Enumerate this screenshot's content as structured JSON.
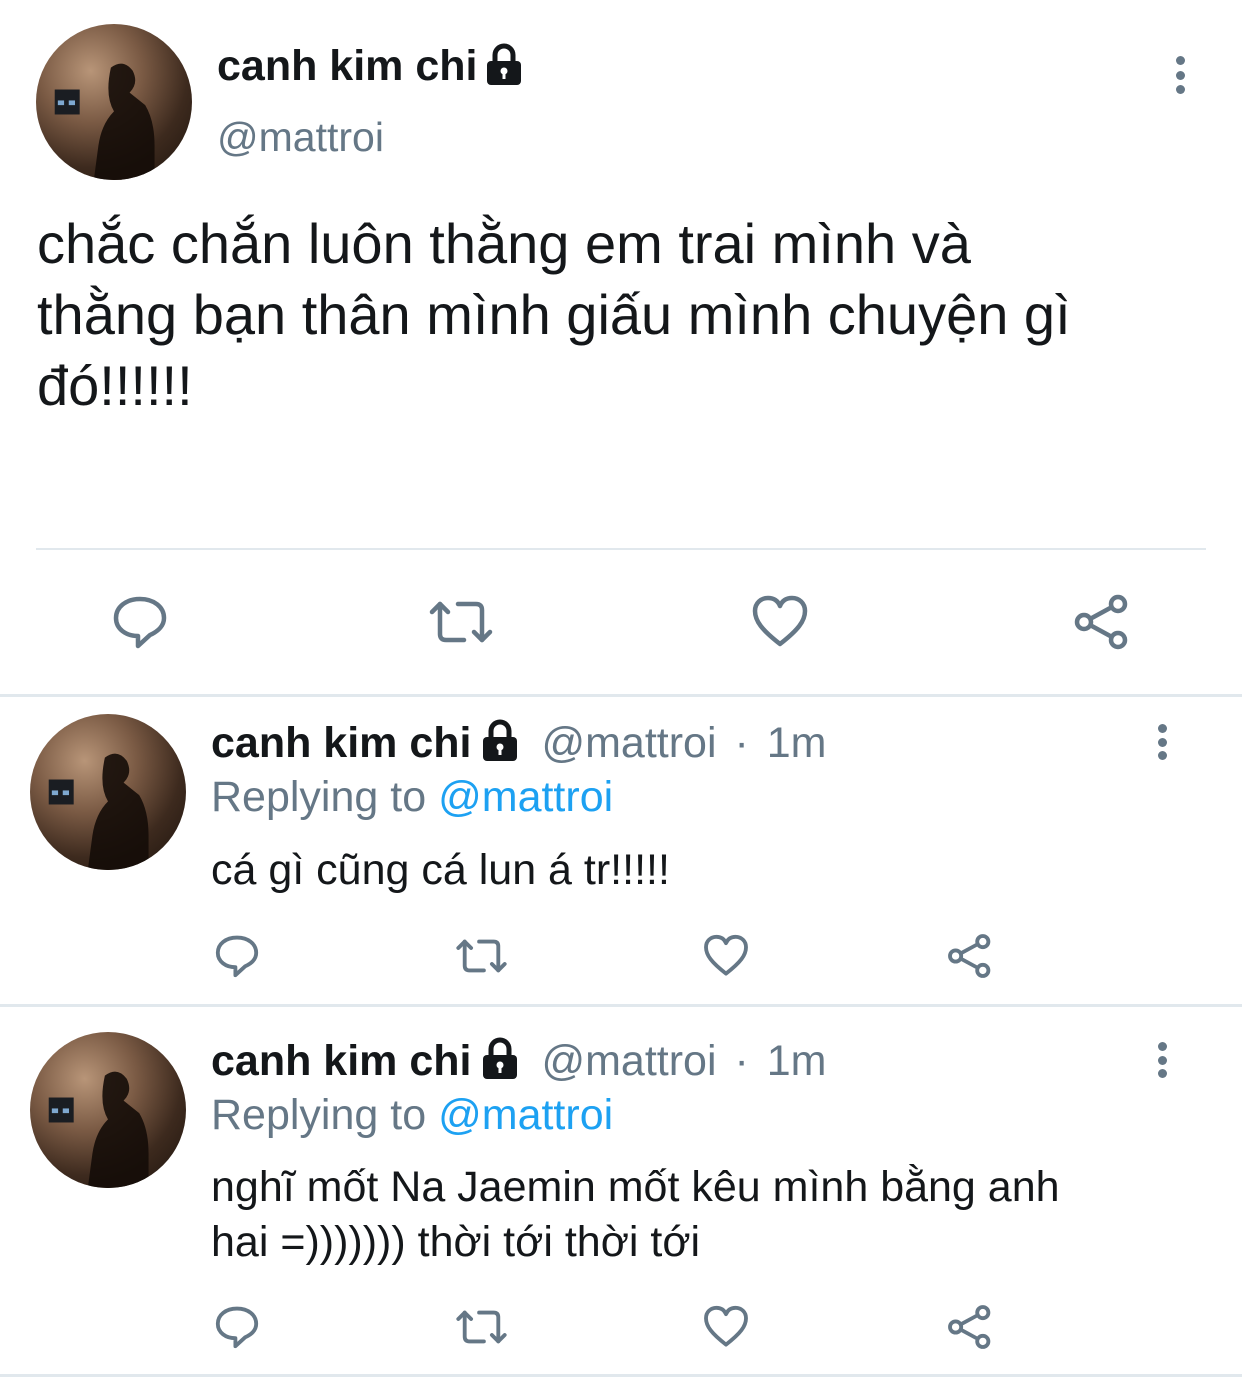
{
  "main_tweet": {
    "display_name": "canh kim chi",
    "handle": "@mattroi",
    "text_line1": "chắc chắn luôn thằng em trai mình và",
    "text_line2": "thằng bạn thân mình giấu mình chuyện gì",
    "text_line3": "đó!!!!!!"
  },
  "replies": [
    {
      "display_name": "canh kim chi",
      "handle": "@mattroi",
      "separator": "·",
      "time": "1m",
      "replying_label": "Replying to",
      "replying_to": "@mattroi",
      "text_line1": "cá gì cũng cá lun á tr!!!!!",
      "text_line2": ""
    },
    {
      "display_name": "canh kim chi",
      "handle": "@mattroi",
      "separator": "·",
      "time": "1m",
      "replying_label": "Replying to",
      "replying_to": "@mattroi",
      "text_line1": "nghĩ mốt Na Jaemin mốt kêu mình bằng anh",
      "text_line2": "hai =))))))) thời tới thời tới"
    }
  ],
  "icons": {
    "reply": "reply-icon",
    "retweet": "retweet-icon",
    "like": "heart-icon",
    "share": "share-icon",
    "more": "more-vertical-icon",
    "lock": "lock-icon"
  },
  "colors": {
    "text": "#14171a",
    "secondary": "#657786",
    "accent": "#1da1f2",
    "divider": "#e1e8ed"
  }
}
